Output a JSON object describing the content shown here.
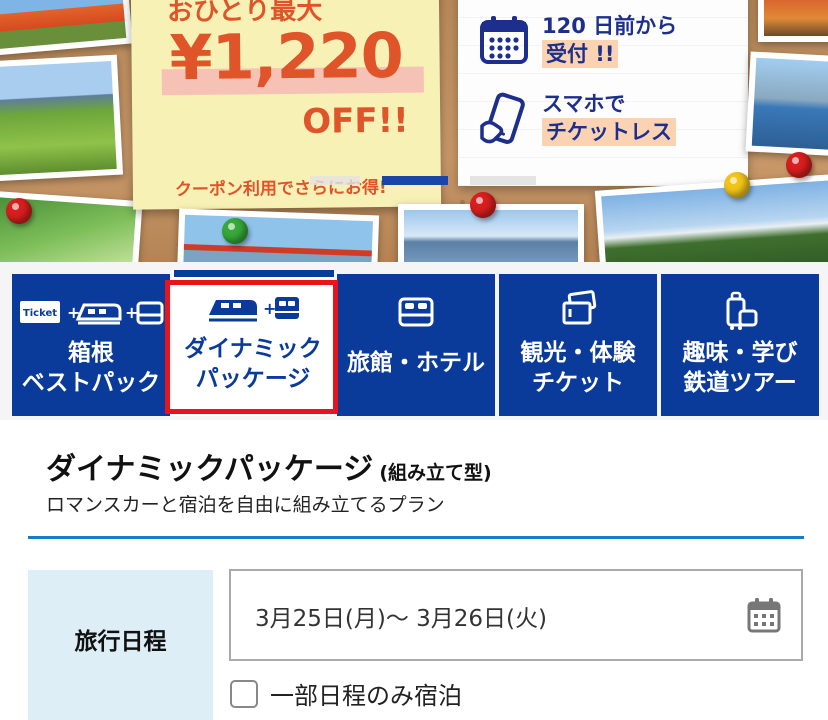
{
  "hero": {
    "lead": "おひとり最大",
    "price": "¥1,220",
    "off": "OFF!!",
    "coupon_note": "クーポン利用でさらにお得!",
    "features": [
      {
        "icon": "calendar-icon",
        "line1": "120 日前から",
        "line2": "受付 !!"
      },
      {
        "icon": "smartphone-icon",
        "line1": "スマホで",
        "line2": "チケットレス"
      }
    ],
    "colors": {
      "accent": "#e0542a",
      "navy": "#1d2f8c"
    }
  },
  "tabs": [
    {
      "label": "箱根\nベストパック",
      "icon": "ticket-train-bed-icon",
      "ticket_text": "Ticket",
      "active": false
    },
    {
      "label": "ダイナミック\nパッケージ",
      "icon": "train-bed-icon",
      "active": true
    },
    {
      "label": "旅館・ホテル",
      "icon": "bed-icon",
      "active": false
    },
    {
      "label": "観光・体験\nチケット",
      "icon": "tickets-icon",
      "active": false
    },
    {
      "label": "趣味・学び\n鉄道ツアー",
      "icon": "luggage-icon",
      "active": false
    }
  ],
  "panel": {
    "title": "ダイナミックパッケージ",
    "title_suffix": "(組み立て型)",
    "subtitle": "ロマンスカーと宿泊を自由に組み立てるプラン",
    "travel_dates_label": "旅行日程",
    "travel_dates_value": "3月25日(月)〜 3月26日(火)",
    "partial_stay_label": "一部日程のみ宿泊",
    "partial_stay_checked": false
  },
  "colors": {
    "tab_blue": "#0a3b9b",
    "highlight_red": "#e8141b",
    "divider_blue": "#1b7cc6",
    "label_bg": "#ddeef7"
  }
}
